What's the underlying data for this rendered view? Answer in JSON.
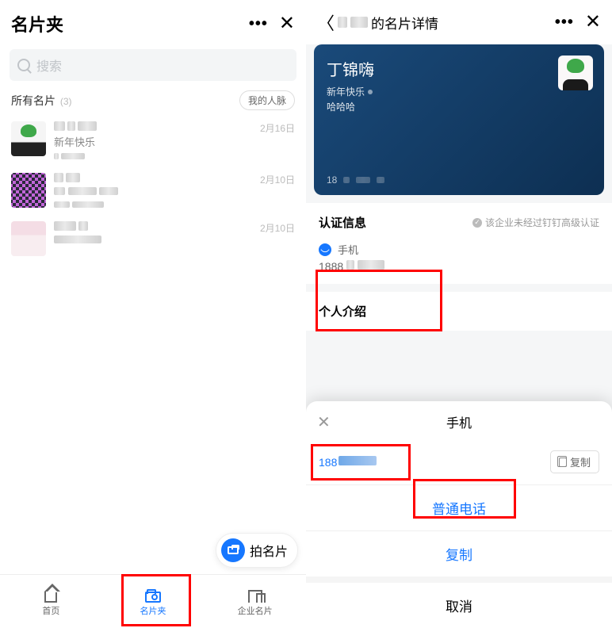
{
  "left": {
    "title": "名片夹",
    "search_placeholder": "搜索",
    "subhead": "所有名片",
    "count": "(3)",
    "pill": "我的人脉",
    "contacts": [
      {
        "sub": "新年快乐",
        "date": "2月16日"
      },
      {
        "date": "2月10日"
      },
      {
        "date": "2月10日"
      }
    ],
    "fab": "拍名片",
    "tabs": {
      "home": "首页",
      "cards": "名片夹",
      "enterprise": "企业名片"
    }
  },
  "right": {
    "title_suffix": "的名片详情",
    "card": {
      "name": "丁锦嗨",
      "sub1": "新年快乐",
      "sub2": "哈哈哈",
      "bottom_prefix": "18"
    },
    "verify": {
      "title": "认证信息",
      "badge": "该企业未经过钉钉高级认证"
    },
    "phone": {
      "label": "手机",
      "number_prefix": "1888"
    },
    "intro_title": "个人介绍",
    "sheet": {
      "title": "手机",
      "number_prefix": "188",
      "copy": "复制",
      "call": "普通电话",
      "copy_action": "复制",
      "cancel": "取消"
    }
  }
}
